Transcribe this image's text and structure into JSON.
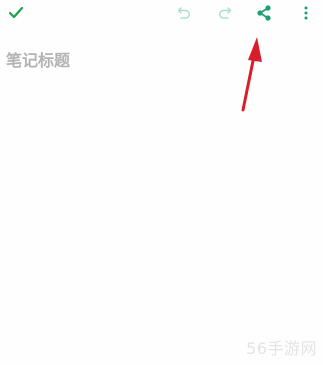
{
  "toolbar": {
    "confirm_icon": "check-icon",
    "undo_icon": "undo-icon",
    "redo_icon": "redo-icon",
    "share_icon": "share-icon",
    "more_icon": "more-vertical-icon",
    "confirm_color": "#1aa34a",
    "accent_color": "#1aa36f",
    "disabled_color": "#a8e0c9"
  },
  "editor": {
    "title_placeholder": "笔记标题",
    "title_value": "",
    "body_value": ""
  },
  "annotation": {
    "arrow_color": "#d81e2a"
  },
  "watermark": {
    "text": "56手游网"
  }
}
